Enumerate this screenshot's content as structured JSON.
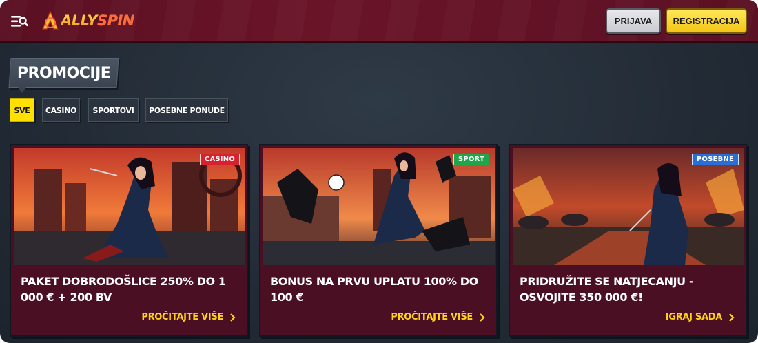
{
  "header": {
    "logo_text_a": "ALLY",
    "logo_text_b": "SPIN",
    "login_label": "PRIJAVA",
    "register_label": "REGISTRACIJA",
    "menu_icon": "menu-search-icon"
  },
  "page": {
    "title": "PROMOCIJE"
  },
  "filters": [
    {
      "label": "SVE",
      "active": true
    },
    {
      "label": "CASINO",
      "active": false
    },
    {
      "label": "SPORTOVI",
      "active": false
    },
    {
      "label": "POSEBNE PONUDE",
      "active": false
    }
  ],
  "cards": [
    {
      "tag": "CASINO",
      "tag_color": "#d9202e",
      "title": "PAKET DOBRODOŠLICE 250% DO 1 000 € + 200 BV",
      "link": "PROČITAJTE VIŠE"
    },
    {
      "tag": "SPORT",
      "tag_color": "#1fa64a",
      "title": "BONUS NA PRVU UPLATU 100% DO 100 €",
      "link": "PROČITAJTE VIŠE"
    },
    {
      "tag": "POSEBNE",
      "tag_color": "#2a6fd6",
      "title": "PRIDRUŽITE SE NATJECANJU - OSVOJITE 350 000 €!",
      "link": "IGRAJ SADA"
    }
  ],
  "colors": {
    "header_bg": "#5a0f22",
    "accent_yellow": "#ffd21a",
    "card_bg": "#4a0f22",
    "page_bg": "#222b35"
  }
}
